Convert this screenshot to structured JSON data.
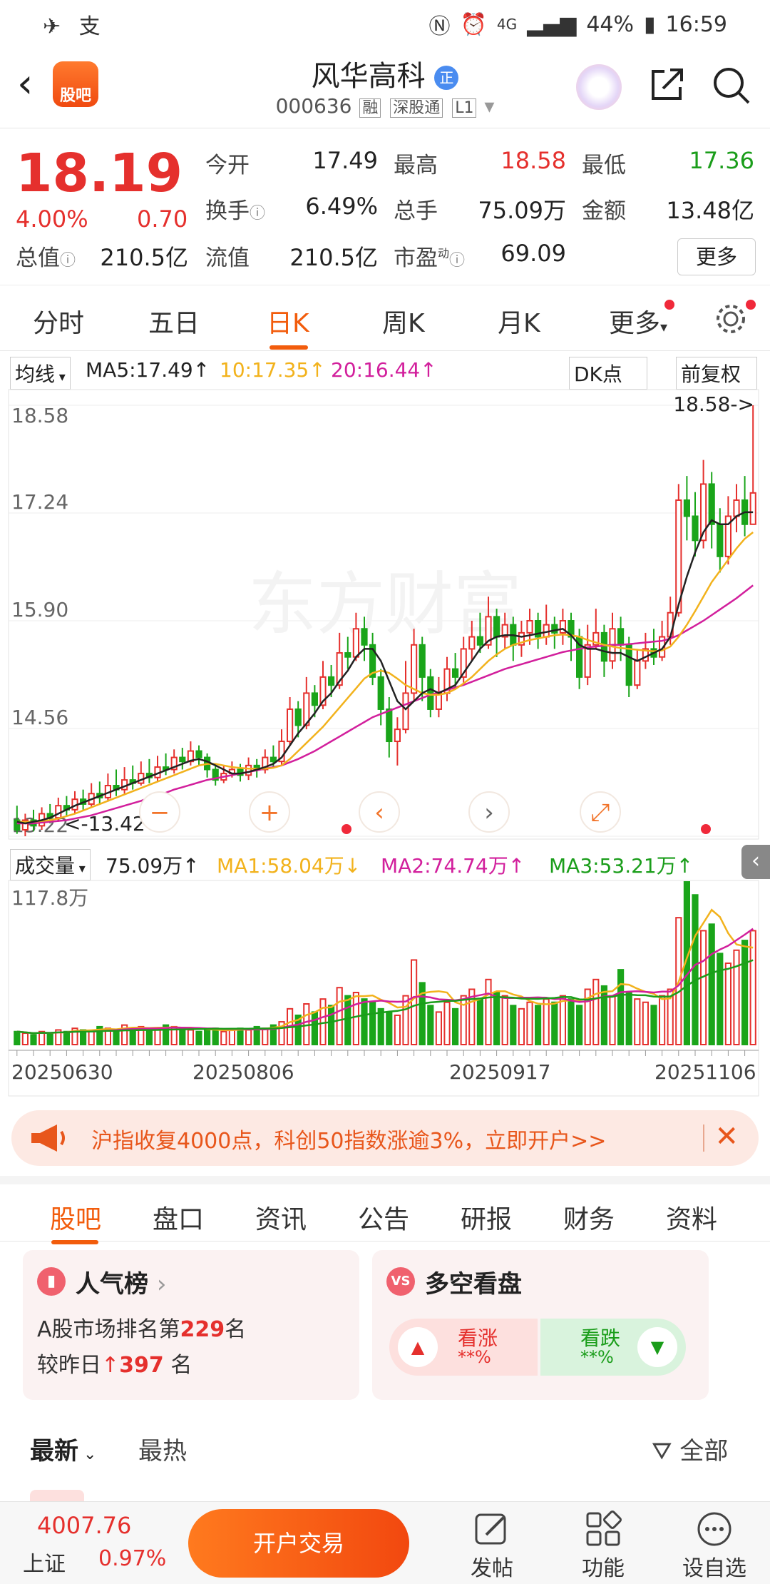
{
  "status_bar": {
    "left_icons": "✈ 支",
    "battery": "44%",
    "time": "16:59",
    "network": "4G"
  },
  "header": {
    "stock_name": "风华高科",
    "name_badge": "正",
    "code": "000636",
    "tags": [
      "融",
      "深股通",
      "L1"
    ]
  },
  "quote": {
    "price": "18.19",
    "change_pct": "4.00%",
    "change": "0.70",
    "items": [
      {
        "label": "今开",
        "value": "17.49",
        "color": "#222"
      },
      {
        "label": "最高",
        "value": "18.58",
        "color": "#e5302d"
      },
      {
        "label": "最低",
        "value": "17.36",
        "color": "#1a9d1a"
      },
      {
        "label": "换手",
        "value": "6.49%",
        "color": "#222"
      },
      {
        "label": "总手",
        "value": "75.09万",
        "color": "#222"
      },
      {
        "label": "金额",
        "value": "13.48亿",
        "color": "#222"
      },
      {
        "label": "总值",
        "value": "210.5亿",
        "color": "#222"
      },
      {
        "label": "流值",
        "value": "210.5亿",
        "color": "#222"
      },
      {
        "label": "市盈",
        "value": "69.09",
        "color": "#222"
      }
    ],
    "pe_superscript": "动",
    "more_button": "更多"
  },
  "tabs": {
    "items": [
      "分时",
      "五日",
      "日K",
      "周K",
      "月K",
      "更多"
    ],
    "active": "日K"
  },
  "ma_row": {
    "selector": "均线",
    "ma5": "MA5:17.49↑",
    "ma10": "10:17.35↑",
    "ma20": "20:16.44↑",
    "dk_button": "DK点",
    "fq_button": "前复权"
  },
  "chart_data": {
    "type": "candlestick",
    "ylabels": [
      "18.58",
      "17.24",
      "15.90",
      "14.56",
      "13.22"
    ],
    "ylim": [
      13.22,
      18.58
    ],
    "high_marker": "18.58->",
    "low_marker": "13.42",
    "x_labels": [
      "20250630",
      "20250806",
      "20250917",
      "20251106"
    ],
    "watermark": "东方财富",
    "candles": [
      [
        13.42,
        13.3,
        13.6,
        13.25
      ],
      [
        13.3,
        13.42,
        13.5,
        13.22
      ],
      [
        13.42,
        13.35,
        13.55,
        13.28
      ],
      [
        13.35,
        13.5,
        13.58,
        13.3
      ],
      [
        13.5,
        13.45,
        13.62,
        13.38
      ],
      [
        13.45,
        13.6,
        13.7,
        13.4
      ],
      [
        13.6,
        13.55,
        13.72,
        13.48
      ],
      [
        13.55,
        13.68,
        13.78,
        13.5
      ],
      [
        13.68,
        13.62,
        13.8,
        13.55
      ],
      [
        13.62,
        13.75,
        13.88,
        13.58
      ],
      [
        13.75,
        13.7,
        13.9,
        13.62
      ],
      [
        13.7,
        13.85,
        14.0,
        13.65
      ],
      [
        13.85,
        13.8,
        14.05,
        13.72
      ],
      [
        13.8,
        13.92,
        14.08,
        13.75
      ],
      [
        13.92,
        13.88,
        14.1,
        13.8
      ],
      [
        13.88,
        14.0,
        14.15,
        13.85
      ],
      [
        14.0,
        13.95,
        14.18,
        13.88
      ],
      [
        13.95,
        14.08,
        14.22,
        13.9
      ],
      [
        14.08,
        14.05,
        14.25,
        13.98
      ],
      [
        14.05,
        14.2,
        14.3,
        14.0
      ],
      [
        14.2,
        14.15,
        14.32,
        14.05
      ],
      [
        14.15,
        14.28,
        14.4,
        14.1
      ],
      [
        14.28,
        14.2,
        14.35,
        14.1
      ],
      [
        14.2,
        14.05,
        14.25,
        13.95
      ],
      [
        14.05,
        13.92,
        14.1,
        13.85
      ],
      [
        13.92,
        14.0,
        14.1,
        13.88
      ],
      [
        14.0,
        14.05,
        14.15,
        13.95
      ],
      [
        14.05,
        13.98,
        14.12,
        13.9
      ],
      [
        13.98,
        14.1,
        14.2,
        13.92
      ],
      [
        14.1,
        14.05,
        14.18,
        13.95
      ],
      [
        14.05,
        14.2,
        14.3,
        14.0
      ],
      [
        14.2,
        14.15,
        14.35,
        14.08
      ],
      [
        14.15,
        14.4,
        14.55,
        14.1
      ],
      [
        14.4,
        14.8,
        14.95,
        14.35
      ],
      [
        14.8,
        14.6,
        14.9,
        14.45
      ],
      [
        14.6,
        15.0,
        15.2,
        14.55
      ],
      [
        15.0,
        14.85,
        15.1,
        14.7
      ],
      [
        14.85,
        15.2,
        15.4,
        14.8
      ],
      [
        15.2,
        15.1,
        15.35,
        14.95
      ],
      [
        15.1,
        15.5,
        15.75,
        15.05
      ],
      [
        15.5,
        15.45,
        15.7,
        15.3
      ],
      [
        15.45,
        15.8,
        16.0,
        15.4
      ],
      [
        15.8,
        15.6,
        15.95,
        15.4
      ],
      [
        15.6,
        15.2,
        15.75,
        15.1
      ],
      [
        15.2,
        14.8,
        15.3,
        14.6
      ],
      [
        14.8,
        14.4,
        14.95,
        14.2
      ],
      [
        14.4,
        14.55,
        14.7,
        14.1
      ],
      [
        14.55,
        15.0,
        15.4,
        14.5
      ],
      [
        15.0,
        15.6,
        15.8,
        14.9
      ],
      [
        15.6,
        15.2,
        15.7,
        14.9
      ],
      [
        15.2,
        14.8,
        15.3,
        14.7
      ],
      [
        14.8,
        15.0,
        15.2,
        14.7
      ],
      [
        15.0,
        15.3,
        15.45,
        14.9
      ],
      [
        15.3,
        15.2,
        15.5,
        15.05
      ],
      [
        15.2,
        15.55,
        15.7,
        15.1
      ],
      [
        15.55,
        15.7,
        15.9,
        15.4
      ],
      [
        15.7,
        15.6,
        16.0,
        15.5
      ],
      [
        15.6,
        15.95,
        16.2,
        15.55
      ],
      [
        15.95,
        15.7,
        16.05,
        15.45
      ],
      [
        15.7,
        15.85,
        16.0,
        15.55
      ],
      [
        15.85,
        15.6,
        15.95,
        15.4
      ],
      [
        15.6,
        15.75,
        15.9,
        15.45
      ],
      [
        15.75,
        15.9,
        16.05,
        15.6
      ],
      [
        15.9,
        15.7,
        16.0,
        15.55
      ],
      [
        15.7,
        15.85,
        16.1,
        15.6
      ],
      [
        15.85,
        15.75,
        15.95,
        15.55
      ],
      [
        15.75,
        15.9,
        16.05,
        15.6
      ],
      [
        15.9,
        15.7,
        16.0,
        15.4
      ],
      [
        15.7,
        15.2,
        15.8,
        15.05
      ],
      [
        15.2,
        15.6,
        15.85,
        15.1
      ],
      [
        15.6,
        15.75,
        16.05,
        15.55
      ],
      [
        15.75,
        15.4,
        15.85,
        15.2
      ],
      [
        15.4,
        15.8,
        16.0,
        15.3
      ],
      [
        15.8,
        15.6,
        15.95,
        15.4
      ],
      [
        15.6,
        15.1,
        15.7,
        14.95
      ],
      [
        15.1,
        15.4,
        15.55,
        15.05
      ],
      [
        15.4,
        15.55,
        15.75,
        15.3
      ],
      [
        15.55,
        15.45,
        15.8,
        15.35
      ],
      [
        15.45,
        15.7,
        15.9,
        15.4
      ],
      [
        15.7,
        16.0,
        16.2,
        15.6
      ],
      [
        16.0,
        17.4,
        17.6,
        15.95
      ],
      [
        17.4,
        17.2,
        17.7,
        16.9
      ],
      [
        17.2,
        16.9,
        17.5,
        16.7
      ],
      [
        16.9,
        17.6,
        17.9,
        16.8
      ],
      [
        17.6,
        17.1,
        17.75,
        16.8
      ],
      [
        17.1,
        16.7,
        17.3,
        16.5
      ],
      [
        16.7,
        17.2,
        17.45,
        16.6
      ],
      [
        17.2,
        17.4,
        17.6,
        17.0
      ],
      [
        17.4,
        17.1,
        17.7,
        16.95
      ],
      [
        17.1,
        17.49,
        18.58,
        17.36
      ]
    ],
    "ma5": [
      13.4,
      13.38,
      13.4,
      13.42,
      13.45,
      13.5,
      13.55,
      13.6,
      13.64,
      13.68,
      13.72,
      13.76,
      13.8,
      13.84,
      13.88,
      13.92,
      13.96,
      14.0,
      14.04,
      14.08,
      14.12,
      14.16,
      14.18,
      14.15,
      14.1,
      14.05,
      14.0,
      14.0,
      14.02,
      14.05,
      14.08,
      14.12,
      14.2,
      14.35,
      14.5,
      14.62,
      14.75,
      14.9,
      15.0,
      15.15,
      15.28,
      15.45,
      15.55,
      15.55,
      15.4,
      15.15,
      14.9,
      14.8,
      14.9,
      15.0,
      15.05,
      15.0,
      15.05,
      15.1,
      15.25,
      15.4,
      15.55,
      15.65,
      15.7,
      15.72,
      15.72,
      15.7,
      15.72,
      15.74,
      15.76,
      15.78,
      15.8,
      15.72,
      15.6,
      15.55,
      15.55,
      15.52,
      15.5,
      15.5,
      15.45,
      15.4,
      15.45,
      15.5,
      15.55,
      15.7,
      16.1,
      16.45,
      16.75,
      17.0,
      17.15,
      17.1,
      17.1,
      17.2,
      17.25,
      17.25
    ],
    "ma10": [
      13.4,
      13.4,
      13.4,
      13.41,
      13.42,
      13.44,
      13.47,
      13.5,
      13.54,
      13.58,
      13.62,
      13.66,
      13.7,
      13.74,
      13.78,
      13.82,
      13.86,
      13.9,
      13.94,
      13.98,
      14.02,
      14.06,
      14.1,
      14.12,
      14.12,
      14.1,
      14.08,
      14.07,
      14.06,
      14.06,
      14.06,
      14.07,
      14.1,
      14.18,
      14.28,
      14.38,
      14.48,
      14.58,
      14.7,
      14.82,
      14.94,
      15.06,
      15.18,
      15.25,
      15.28,
      15.25,
      15.18,
      15.1,
      15.05,
      15.0,
      14.98,
      14.98,
      15.0,
      15.05,
      15.12,
      15.2,
      15.3,
      15.4,
      15.48,
      15.55,
      15.6,
      15.63,
      15.66,
      15.68,
      15.7,
      15.72,
      15.73,
      15.72,
      15.7,
      15.66,
      15.63,
      15.6,
      15.58,
      15.56,
      15.55,
      15.54,
      15.53,
      15.52,
      15.53,
      15.58,
      15.7,
      15.85,
      16.02,
      16.2,
      16.38,
      16.52,
      16.66,
      16.8,
      16.92,
      17.0
    ],
    "ma20": [
      13.38,
      13.38,
      13.38,
      13.39,
      13.4,
      13.41,
      13.42,
      13.44,
      13.46,
      13.48,
      13.51,
      13.54,
      13.57,
      13.6,
      13.63,
      13.66,
      13.7,
      13.73,
      13.76,
      13.8,
      13.83,
      13.86,
      13.89,
      13.92,
      13.94,
      13.96,
      13.98,
      14.0,
      14.02,
      14.04,
      14.06,
      14.08,
      14.1,
      14.14,
      14.18,
      14.23,
      14.28,
      14.34,
      14.4,
      14.46,
      14.52,
      14.58,
      14.64,
      14.7,
      14.74,
      14.78,
      14.82,
      14.86,
      14.9,
      14.94,
      14.98,
      15.01,
      15.04,
      15.07,
      15.1,
      15.14,
      15.18,
      15.22,
      15.26,
      15.3,
      15.33,
      15.36,
      15.39,
      15.42,
      15.45,
      15.48,
      15.51,
      15.53,
      15.55,
      15.57,
      15.58,
      15.59,
      15.6,
      15.6,
      15.61,
      15.62,
      15.63,
      15.64,
      15.65,
      15.68,
      15.72,
      15.78,
      15.84,
      15.9,
      15.97,
      16.04,
      16.11,
      16.18,
      16.26,
      16.34
    ]
  },
  "chart_controls": [
    "−",
    "+",
    "‹",
    "›",
    "⤢"
  ],
  "volume_row": {
    "selector": "成交量",
    "vol": "75.09万↑",
    "ma1": "MA1:58.04万↓",
    "ma2": "MA2:74.74万↑",
    "ma3": "MA3:53.21万↑",
    "ylabel": "117.8万"
  },
  "volume_data": {
    "values": [
      8,
      7,
      6,
      8,
      7,
      9,
      8,
      10,
      9,
      8,
      11,
      10,
      9,
      12,
      10,
      11,
      9,
      10,
      12,
      11,
      10,
      9,
      8,
      9,
      10,
      8,
      9,
      10,
      9,
      11,
      10,
      12,
      14,
      22,
      18,
      25,
      20,
      28,
      24,
      35,
      30,
      32,
      28,
      26,
      22,
      20,
      18,
      30,
      52,
      38,
      24,
      20,
      26,
      22,
      30,
      34,
      28,
      40,
      32,
      30,
      24,
      22,
      26,
      24,
      28,
      26,
      30,
      28,
      24,
      34,
      40,
      36,
      30,
      46,
      32,
      28,
      26,
      24,
      30,
      34,
      78,
      100,
      92,
      70,
      74,
      56,
      50,
      58,
      64,
      70
    ]
  },
  "banner": {
    "text": "沪指收复4000点，科创50指数涨逾3%，立即开户>>"
  },
  "subtabs": {
    "items": [
      "股吧",
      "盘口",
      "资讯",
      "公告",
      "研报",
      "财务",
      "资料"
    ],
    "active": "股吧"
  },
  "popularity_card": {
    "title": "人气榜",
    "rank_prefix": "A股市场排名第",
    "rank": "229",
    "rank_suffix": "名",
    "change_prefix": "较昨日",
    "change": "397",
    "change_suffix": "名"
  },
  "sentiment_card": {
    "title": "多空看盘",
    "bull_label": "看涨",
    "bull_value": "**%",
    "bear_label": "看跌",
    "bear_value": "**%"
  },
  "sort_row": {
    "latest": "最新",
    "hottest": "最热",
    "filter": "全部"
  },
  "bottom_bar": {
    "index_value": "4007.76",
    "index_name": "上证",
    "index_pct": "0.97%",
    "open_button": "开户交易",
    "post": "发帖",
    "functions": "功能",
    "watchlist": "设自选"
  }
}
